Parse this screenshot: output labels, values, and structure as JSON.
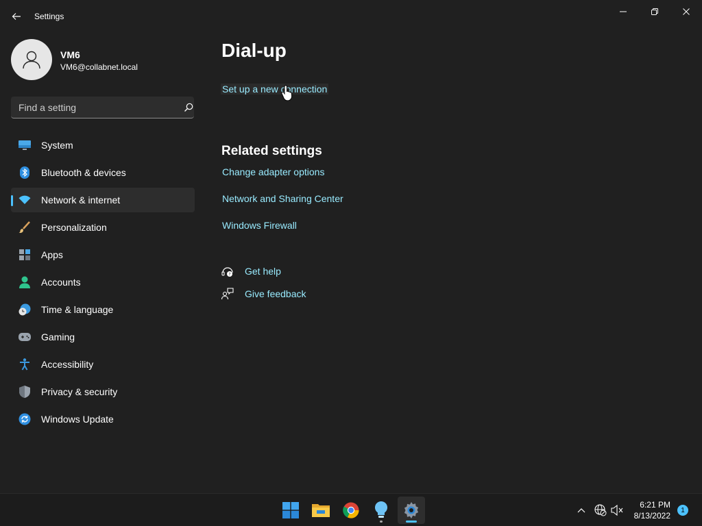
{
  "window": {
    "title": "Settings",
    "controls": [
      "minimize",
      "restore",
      "close"
    ]
  },
  "profile": {
    "name": "VM6",
    "email": "VM6@collabnet.local"
  },
  "search": {
    "placeholder": "Find a setting",
    "value": ""
  },
  "sidebar": {
    "items": [
      {
        "label": "System",
        "icon": "monitor-icon",
        "active": false
      },
      {
        "label": "Bluetooth & devices",
        "icon": "bluetooth-icon",
        "active": false
      },
      {
        "label": "Network & internet",
        "icon": "wifi-icon",
        "active": true
      },
      {
        "label": "Personalization",
        "icon": "brush-icon",
        "active": false
      },
      {
        "label": "Apps",
        "icon": "apps-icon",
        "active": false
      },
      {
        "label": "Accounts",
        "icon": "person-icon",
        "active": false
      },
      {
        "label": "Time & language",
        "icon": "clock-globe-icon",
        "active": false
      },
      {
        "label": "Gaming",
        "icon": "gamepad-icon",
        "active": false
      },
      {
        "label": "Accessibility",
        "icon": "accessibility-icon",
        "active": false
      },
      {
        "label": "Privacy & security",
        "icon": "shield-icon",
        "active": false
      },
      {
        "label": "Windows Update",
        "icon": "update-icon",
        "active": false
      }
    ]
  },
  "main": {
    "title": "Dial-up",
    "setup_link": "Set up a new connection",
    "related": {
      "title": "Related settings",
      "links": [
        "Change adapter options",
        "Network and Sharing Center",
        "Windows Firewall"
      ]
    },
    "help": {
      "get_help": "Get help",
      "give_feedback": "Give feedback"
    }
  },
  "taskbar": {
    "apps": [
      "start-icon",
      "file-explorer-icon",
      "chrome-icon",
      "tips-icon",
      "settings-icon"
    ],
    "active_app": "settings-icon",
    "time": "6:21 PM",
    "date": "8/13/2022",
    "notification_count": "1"
  },
  "colors": {
    "background": "#202020",
    "accent": "#4cc2ff",
    "link": "#99ebff",
    "nav_active": "#2d2d2d"
  }
}
